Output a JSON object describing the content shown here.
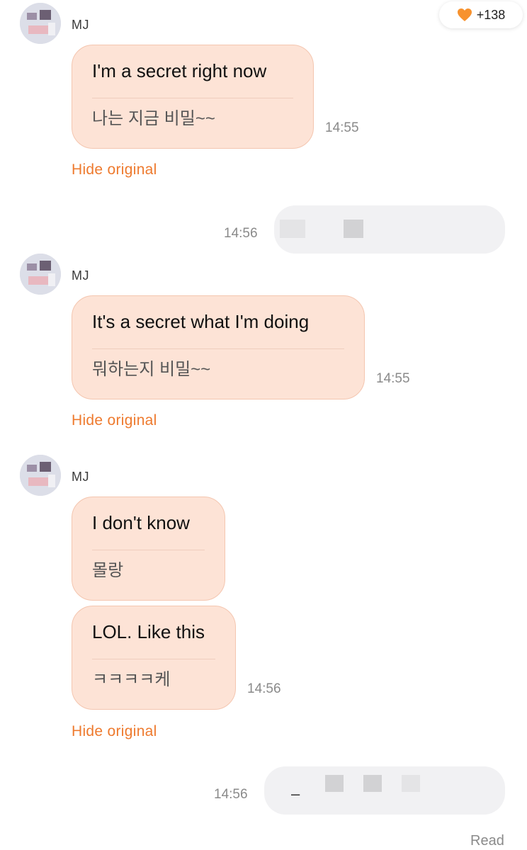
{
  "like_badge": {
    "icon": "orange-heart-icon",
    "count": "+138",
    "heart_color": "#f7922e"
  },
  "messages": [
    {
      "sender": "MJ",
      "bubbles": [
        {
          "translation": "I'm a secret right now",
          "original": "나는 지금 비밀~~"
        }
      ],
      "time": "14:55",
      "hide_label": "Hide original"
    },
    {
      "outgoing": true,
      "time": "14:56",
      "content_censored": true
    },
    {
      "sender": "MJ",
      "bubbles": [
        {
          "translation": "It's a secret what I'm doing",
          "original": "뭐하는지 비밀~~"
        }
      ],
      "time": "14:55",
      "hide_label": "Hide original"
    },
    {
      "sender": "MJ",
      "bubbles": [
        {
          "translation": "I don't know",
          "original": "몰랑"
        },
        {
          "translation": "LOL. Like this",
          "original": "ㅋㅋㅋㅋ케"
        }
      ],
      "time": "14:56",
      "hide_label": "Hide original"
    },
    {
      "outgoing": true,
      "time": "14:56",
      "visible_fragment": "–",
      "content_censored": true
    }
  ],
  "status": {
    "read_label": "Read"
  },
  "colors": {
    "incoming_bubble": "#fde3d6",
    "link": "#ee7a2e",
    "outgoing_bubble": "#f1f1f3"
  }
}
